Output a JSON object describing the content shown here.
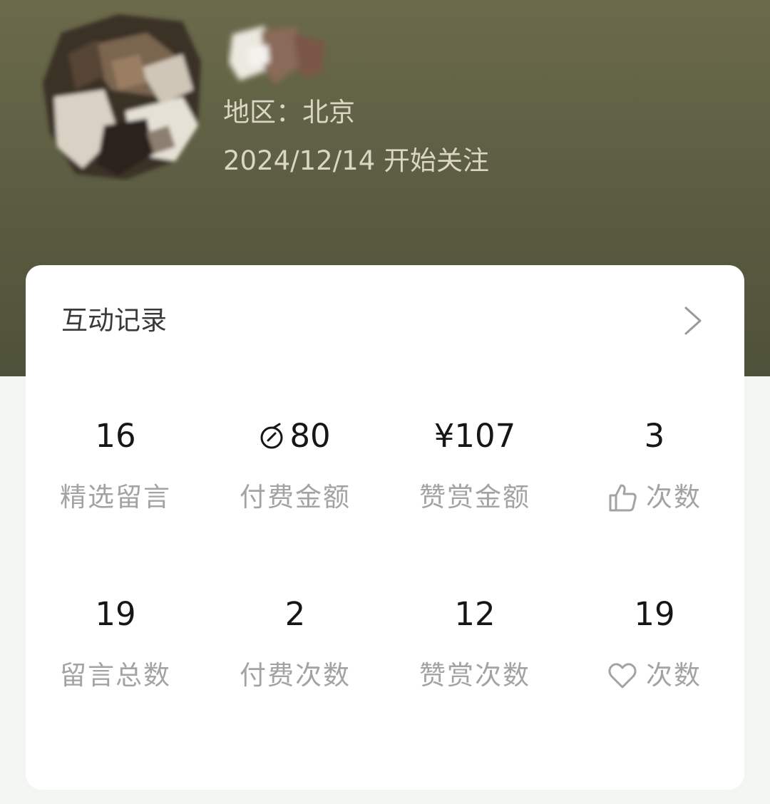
{
  "profile": {
    "region_text": "地区：北京",
    "follow_text": "2024/12/14 开始关注"
  },
  "card": {
    "title": "互动记录",
    "rows": [
      [
        {
          "value": "16",
          "label": "精选留言"
        },
        {
          "value": "80",
          "value_icon": "coin-icon",
          "label": "付费金额"
        },
        {
          "value": "¥107",
          "label": "赞赏金额"
        },
        {
          "value": "3",
          "label": "次数",
          "label_icon": "thumbs-up-icon"
        }
      ],
      [
        {
          "value": "19",
          "label": "留言总数"
        },
        {
          "value": "2",
          "label": "付费次数"
        },
        {
          "value": "12",
          "label": "赞赏次数"
        },
        {
          "value": "19",
          "label": "次数",
          "label_icon": "heart-icon"
        }
      ]
    ]
  },
  "colors": {
    "header_bg": "#5d5e43",
    "card_bg": "#ffffff",
    "value_text": "#161616",
    "label_text": "#a3a3a3"
  }
}
